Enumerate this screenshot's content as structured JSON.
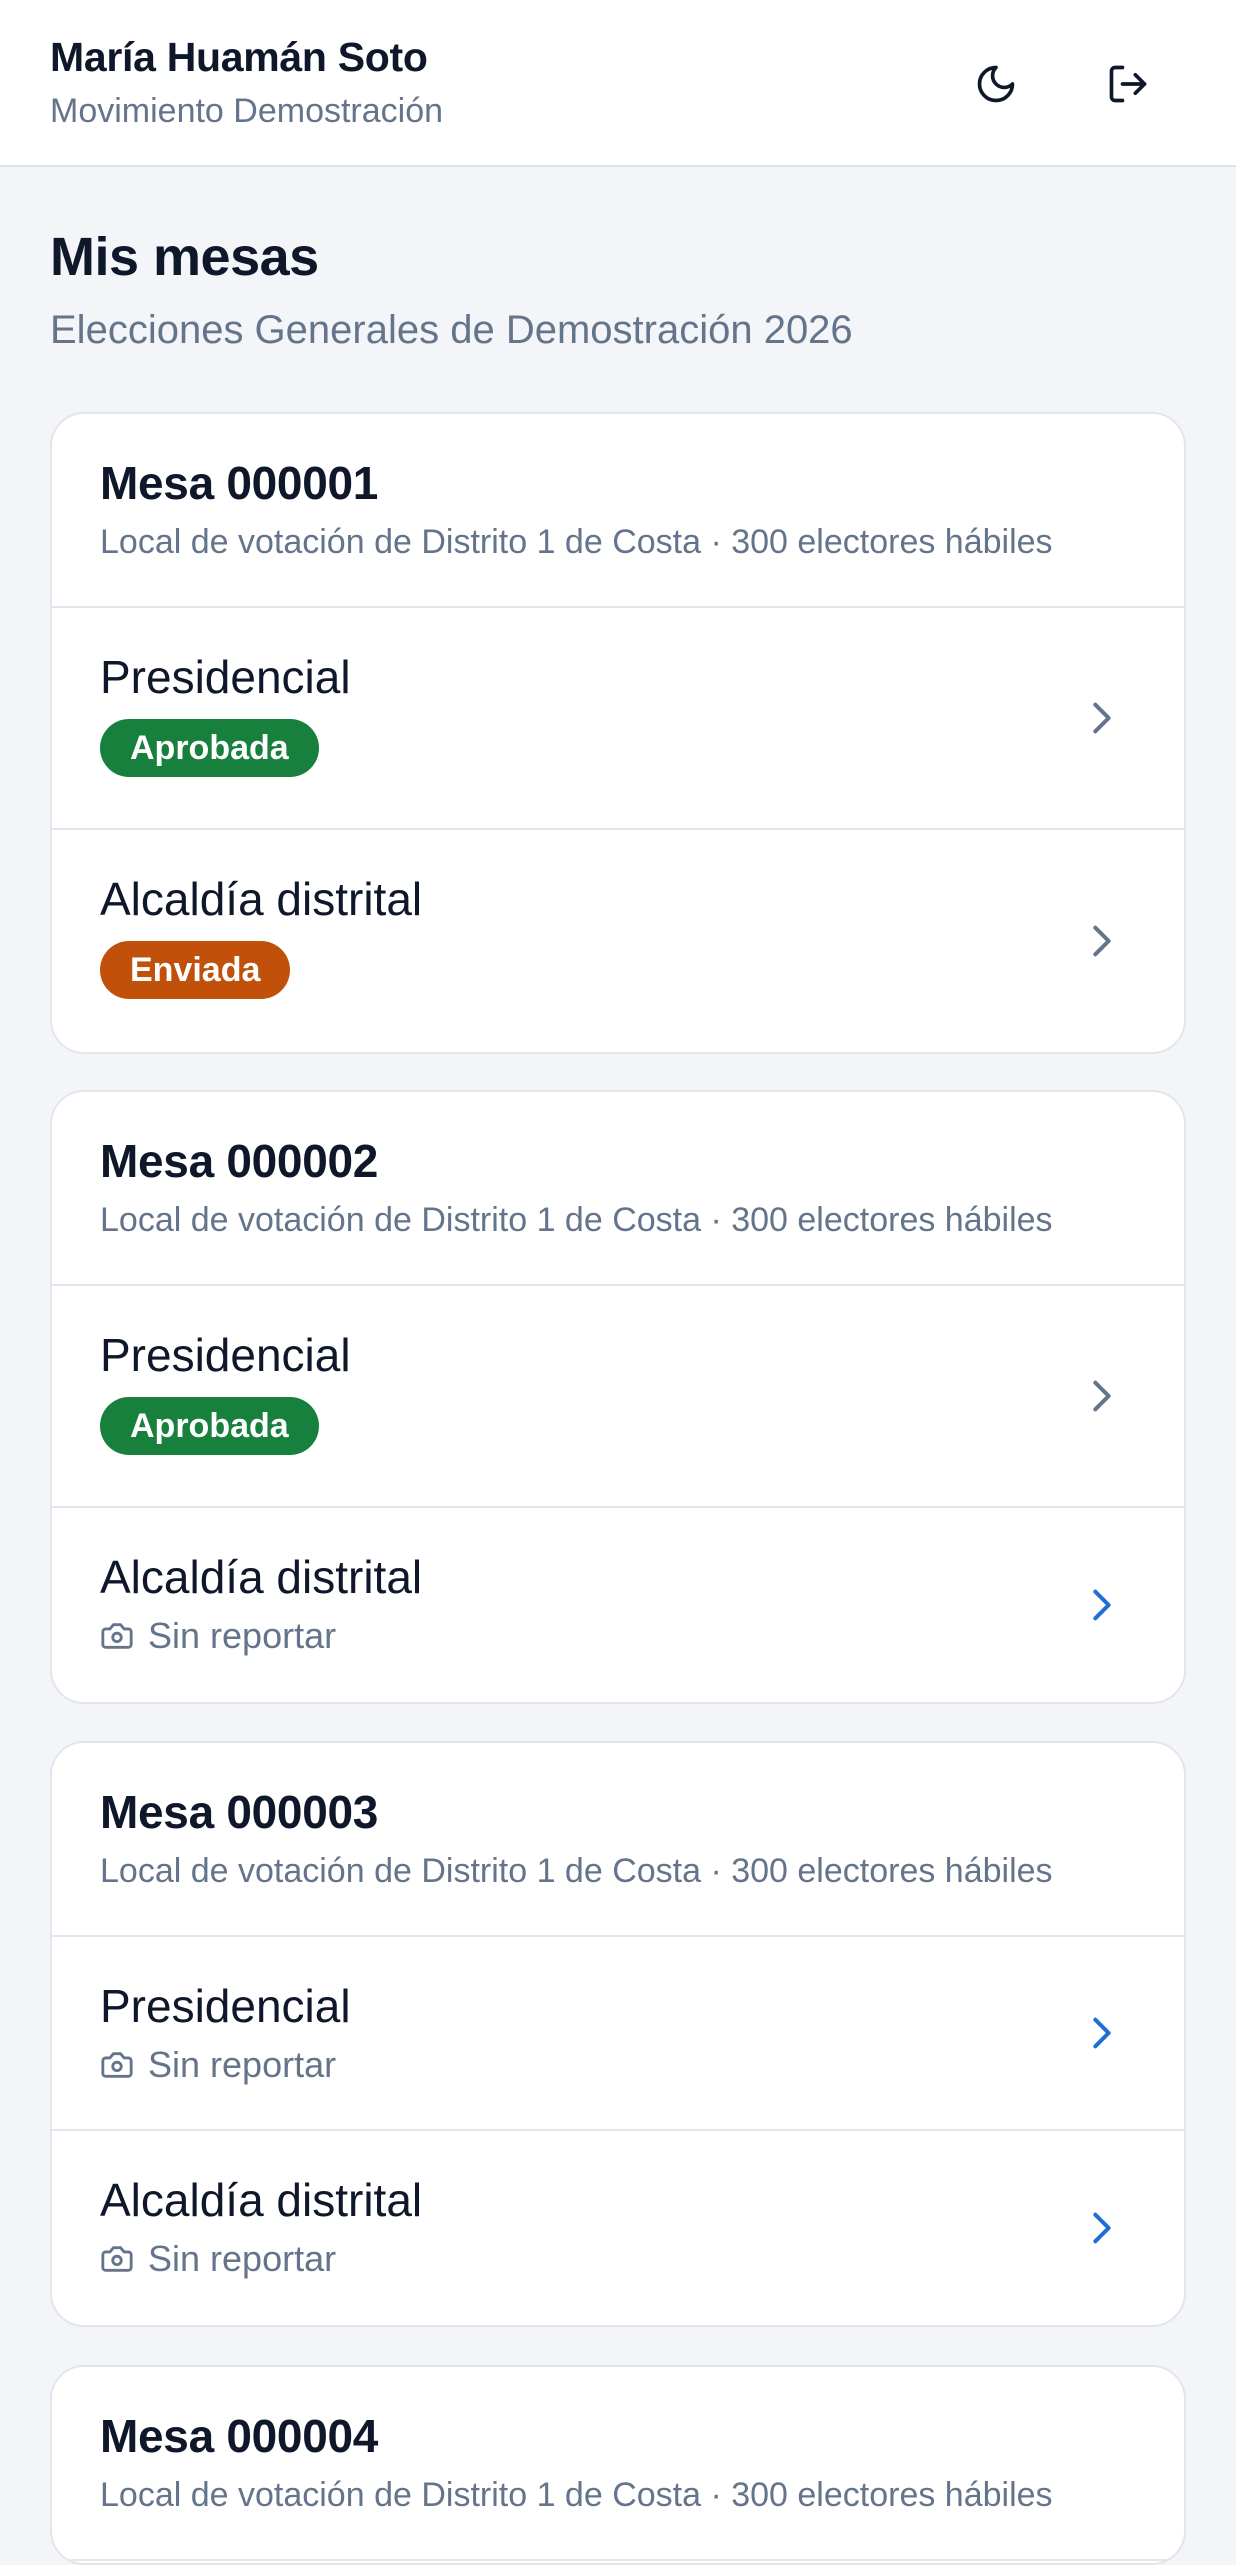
{
  "header": {
    "user_name": "María Huamán Soto",
    "organization": "Movimiento Demostración",
    "theme_icon": "moon-icon",
    "logout_icon": "logout-icon"
  },
  "page": {
    "title": "Mis mesas",
    "subtitle": "Elecciones Generales de Demostración 2026"
  },
  "colors": {
    "approved": "#17803d",
    "sent": "#c0500a",
    "chevron_muted": "#64748b",
    "chevron_active": "#1d6fd6"
  },
  "mesas": [
    {
      "title": "Mesa 000001",
      "meta": "Local de votación de Distrito 1 de Costa · 300 electores hábiles",
      "elections": [
        {
          "name": "Presidencial",
          "status": "Aprobada"
        },
        {
          "name": "Alcaldía distrital",
          "status": "Enviada"
        }
      ]
    },
    {
      "title": "Mesa 000002",
      "meta": "Local de votación de Distrito 1 de Costa · 300 electores hábiles",
      "elections": [
        {
          "name": "Presidencial",
          "status": "Aprobada"
        },
        {
          "name": "Alcaldía distrital",
          "status": "Sin reportar"
        }
      ]
    },
    {
      "title": "Mesa 000003",
      "meta": "Local de votación de Distrito 1 de Costa · 300 electores hábiles",
      "elections": [
        {
          "name": "Presidencial",
          "status": "Sin reportar"
        },
        {
          "name": "Alcaldía distrital",
          "status": "Sin reportar"
        }
      ]
    },
    {
      "title": "Mesa 000004",
      "meta": "Local de votación de Distrito 1 de Costa · 300 electores hábiles",
      "elections": []
    }
  ]
}
